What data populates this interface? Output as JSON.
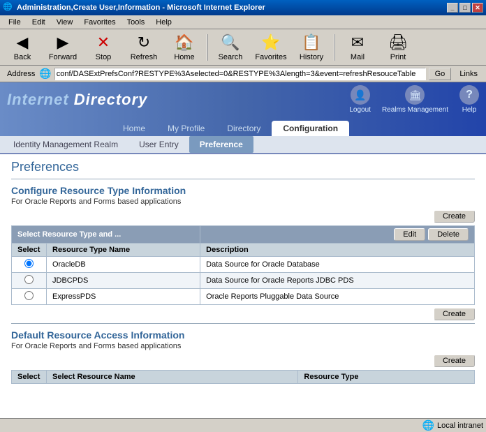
{
  "titleBar": {
    "title": "Administration,Create User,Information - Microsoft Internet Explorer",
    "icon": "🌐",
    "buttons": [
      "_",
      "□",
      "✕"
    ]
  },
  "menuBar": {
    "items": [
      "File",
      "Edit",
      "View",
      "Favorites",
      "Tools",
      "Help"
    ]
  },
  "toolbar": {
    "buttons": [
      {
        "id": "back",
        "label": "Back",
        "icon": "◀"
      },
      {
        "id": "forward",
        "label": "Forward",
        "icon": "▶"
      },
      {
        "id": "stop",
        "label": "Stop",
        "icon": "✕"
      },
      {
        "id": "refresh",
        "label": "Refresh",
        "icon": "↻"
      },
      {
        "id": "home",
        "label": "Home",
        "icon": "🏠"
      },
      {
        "id": "search",
        "label": "Search",
        "icon": "🔍"
      },
      {
        "id": "favorites",
        "label": "Favorites",
        "icon": "⭐"
      },
      {
        "id": "history",
        "label": "History",
        "icon": "📋"
      },
      {
        "id": "mail",
        "label": "Mail",
        "icon": "✉"
      },
      {
        "id": "print",
        "label": "Print",
        "icon": "🖨"
      }
    ]
  },
  "addressBar": {
    "label": "Address",
    "value": "conf/DASExtPrefsConf?RESTYPE%3Aselected=0&RESTYPE%3Alength=3&event=refreshResouceTable",
    "goLabel": "Go",
    "linksLabel": "Links"
  },
  "header": {
    "logo": "Internet Directory",
    "topLinks": [
      {
        "id": "logout",
        "label": "Logout",
        "icon": "👤"
      },
      {
        "id": "realms",
        "label": "Realms Management",
        "icon": "🏛"
      },
      {
        "id": "help",
        "label": "Help",
        "icon": "?"
      }
    ]
  },
  "navTabs": [
    {
      "id": "home",
      "label": "Home",
      "active": false
    },
    {
      "id": "myprofile",
      "label": "My Profile",
      "active": false
    },
    {
      "id": "directory",
      "label": "Directory",
      "active": false
    },
    {
      "id": "configuration",
      "label": "Configuration",
      "active": true
    }
  ],
  "subNav": [
    {
      "id": "identity",
      "label": "Identity Management Realm",
      "active": false
    },
    {
      "id": "userentry",
      "label": "User Entry",
      "active": false
    },
    {
      "id": "preference",
      "label": "Preference",
      "active": true
    }
  ],
  "page": {
    "title": "Preferences",
    "section1": {
      "title": "Configure Resource Type Information",
      "desc": "For Oracle Reports and Forms based applications",
      "tableHeader": "Select Resource Type and ...",
      "createLabel": "Create",
      "editLabel": "Edit",
      "deleteLabel": "Delete",
      "createLabel2": "Create",
      "columns": [
        "Select",
        "Resource Type Name",
        "Description"
      ],
      "rows": [
        {
          "selected": true,
          "name": "OracleDB",
          "desc": "Data Source for Oracle Database"
        },
        {
          "selected": false,
          "name": "JDBCPDS",
          "desc": "Data Source for Oracle Reports JDBC PDS"
        },
        {
          "selected": false,
          "name": "ExpressPDS",
          "desc": "Oracle Reports Pluggable Data Source"
        }
      ]
    },
    "section2": {
      "title": "Default Resource Access Information",
      "desc": "For Oracle Reports and Forms based applications",
      "createLabel": "Create",
      "tableHeader": "Select Resource Name",
      "tableHeader2": "Resource Type"
    }
  },
  "statusBar": {
    "left": "",
    "right": "Local intranet"
  }
}
